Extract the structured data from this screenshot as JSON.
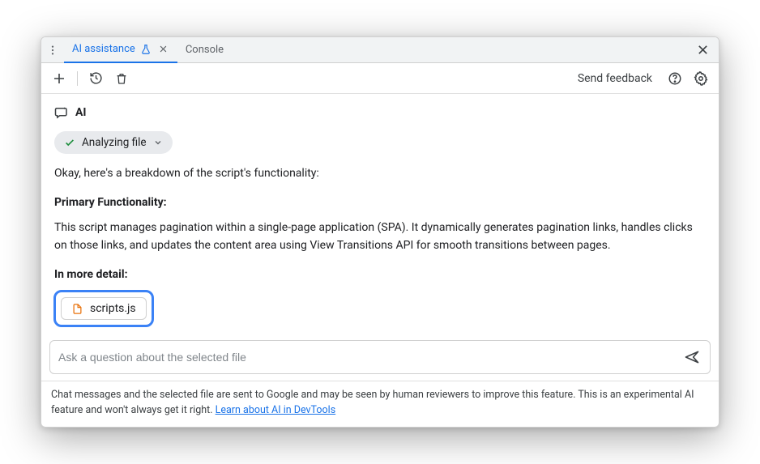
{
  "tabs": {
    "ai_label": "AI assistance",
    "console_label": "Console"
  },
  "toolbar": {
    "feedback_label": "Send feedback"
  },
  "ai": {
    "header_label": "AI",
    "status_chip": "Analyzing file"
  },
  "response": {
    "intro": "Okay, here's a breakdown of the script's functionality:",
    "h1": "Primary Functionality:",
    "p1": "This script manages pagination within a single-page application (SPA). It dynamically generates pagination links, handles clicks on those links, and updates the content area using View Transitions API for smooth transitions between pages.",
    "h2": "In more detail:"
  },
  "file_chip": {
    "filename": "scripts.js"
  },
  "input": {
    "placeholder": "Ask a question about the selected file"
  },
  "footer": {
    "text": "Chat messages and the selected file are sent to Google and may be seen by human reviewers to improve this feature. This is an experimental AI feature and won't always get it right. ",
    "link_text": "Learn about AI in DevTools"
  }
}
